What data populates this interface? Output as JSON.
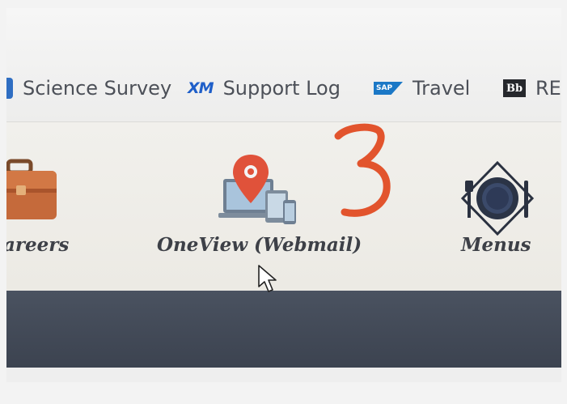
{
  "bookmarks": {
    "items": [
      {
        "label": "Science Survey",
        "icon": "science-icon"
      },
      {
        "label": "Support Log",
        "icon": "xm-icon",
        "icon_text": "XM"
      },
      {
        "label": "Travel",
        "icon": "sap-icon",
        "icon_text": "SAP"
      },
      {
        "label": "RE",
        "icon": "bb-icon",
        "icon_text": "Bb"
      }
    ]
  },
  "tiles": {
    "items": [
      {
        "label": "areers",
        "icon": "briefcase-icon"
      },
      {
        "label": "OneView (Webmail)",
        "icon": "map-pin-devices-icon"
      },
      {
        "label": "Menus",
        "icon": "plate-cutlery-icon"
      }
    ]
  },
  "annotation": {
    "handwritten_number": "3",
    "color": "#e2542d"
  },
  "colors": {
    "banner": "#434a57",
    "accent_red": "#e45b3c"
  }
}
